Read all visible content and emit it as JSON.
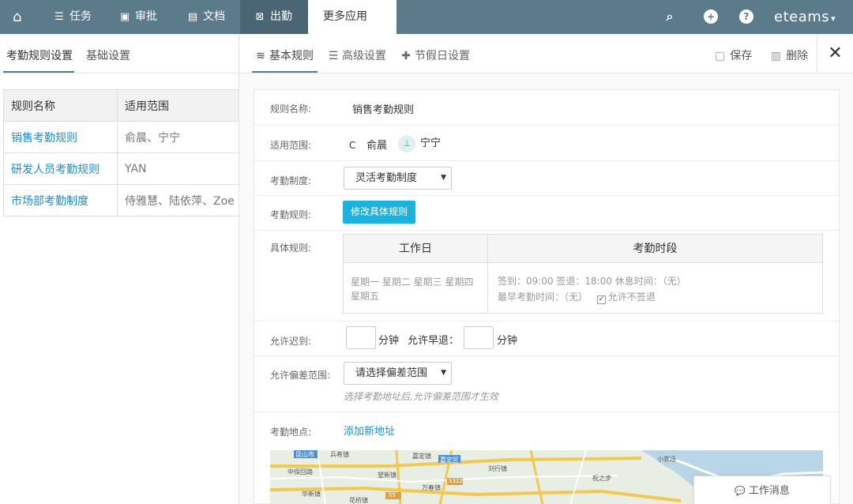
{
  "topnav": {
    "items": [
      {
        "label": "任务",
        "icon": "list-icon"
      },
      {
        "label": "审批",
        "icon": "approval-icon"
      },
      {
        "label": "文档",
        "icon": "document-icon"
      },
      {
        "label": "出勤",
        "icon": "attendance-icon"
      },
      {
        "label": "更多应用"
      }
    ],
    "brand": "eteams",
    "color": "#5b7a8a"
  },
  "left": {
    "tabs": [
      "考勤规则设置",
      "基础设置"
    ],
    "table": {
      "headers": [
        "规则名称",
        "适用范围"
      ],
      "rows": [
        {
          "name": "销售考勤规则",
          "scope": "俞晨、宁宁"
        },
        {
          "name": "研发人员考勤规则",
          "scope": "YAN"
        },
        {
          "name": "市场部考勤制度",
          "scope": "侍雅慧、陆依萍、Zoe"
        }
      ]
    }
  },
  "right": {
    "tabs": [
      "基本规则",
      "高级设置",
      "节假日设置"
    ],
    "actions": {
      "save": "保存",
      "delete": "删除"
    },
    "form": {
      "rule_name": {
        "label": "规则名称:",
        "value": "销售考勤规则"
      },
      "scope": {
        "label": "适用范围:",
        "avatar1_initial": "C",
        "person1": "俞晨",
        "person2": "宁宁"
      },
      "system": {
        "label": "考勤制度:",
        "selected": "灵活考勤制度"
      },
      "rules": {
        "label": "考勤规则:",
        "button": "修改具体规则"
      },
      "detail": {
        "label": "具体规则:",
        "col_workday": "工作日",
        "col_period": "考勤时段",
        "workdays": "星期一 星期二 星期三 星期四 星期五",
        "period_line1": "签到：09:00  签退：18:00  休息时间：（无）",
        "period_line2": "最早考勤时间：（无）",
        "allow_no_checkout": "允许不签退"
      },
      "late": {
        "label": "允许迟到:",
        "unit1": "分钟",
        "early_label": "允许早退：",
        "unit2": "分钟"
      },
      "deviation": {
        "label": "允许偏差范围:",
        "placeholder": "请选择偏差范围",
        "hint": "选择考勤地址后,允许偏差范围才生效"
      },
      "location": {
        "label": "考勤地点:",
        "add": "添加新地址"
      }
    }
  },
  "map_labels": [
    "昆山市",
    "兵希镇",
    "中保回路",
    "望新镇",
    "华新镇",
    "嘉定镇",
    "嘉定区",
    "S322",
    "刘行镇",
    "S5",
    "万春镇",
    "花桥镇",
    "祝之步",
    "小农场"
  ],
  "chat": {
    "label": "工作消息"
  }
}
